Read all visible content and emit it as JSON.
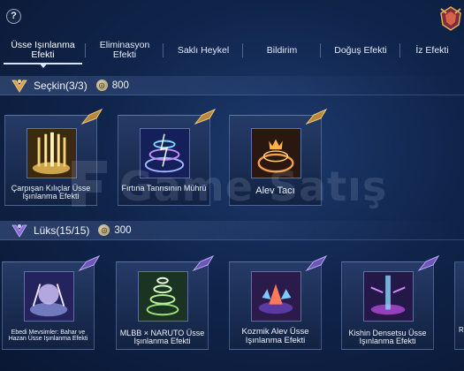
{
  "header": {
    "help_label": "?"
  },
  "tabs": [
    {
      "label": "Üsse Işınlanma Efekti",
      "active": true
    },
    {
      "label": "Eliminasyon Efekti",
      "active": false
    },
    {
      "label": "Saklı Heykel",
      "active": false
    },
    {
      "label": "Bildirim",
      "active": false
    },
    {
      "label": "Doğuş Efekti",
      "active": false
    },
    {
      "label": "İz Efekti",
      "active": false
    }
  ],
  "sections": [
    {
      "title": "Seçkin(3/3)",
      "price": "800",
      "items": [
        {
          "label": "Çarpışan Kılıçlar Üsse Işınlanma Efekti",
          "icon": "golden-swords-icon"
        },
        {
          "label": "Fırtına Tanrısının Mührü",
          "icon": "storm-seal-icon"
        },
        {
          "label": "Alev Tacı",
          "icon": "flame-crown-icon"
        }
      ]
    },
    {
      "title": "Lüks(15/15)",
      "price": "300",
      "items": [
        {
          "label": "Ebedi Mevsimler: Bahar ve Hazan Üsse Işınlanma Efekti",
          "icon": "eternal-seasons-icon"
        },
        {
          "label": "MLBB × NARUTO Üsse Işınlanma Efekti",
          "icon": "green-whirlwind-icon"
        },
        {
          "label": "Kozmik Alev Üsse Işınlanma Efekti",
          "icon": "cosmic-flame-icon"
        },
        {
          "label": "Kishin Densetsu Üsse Işınlanma Efekti",
          "icon": "kishin-beam-icon"
        },
        {
          "label": "R",
          "icon": "partial-card-icon"
        }
      ]
    }
  ],
  "watermark": {
    "text": "Game Satış"
  },
  "colors": {
    "background": "#10254c",
    "gold_accent": "#d8a24a",
    "purple_accent": "#8a6ad8",
    "tab_active": "#d9e6ff"
  }
}
